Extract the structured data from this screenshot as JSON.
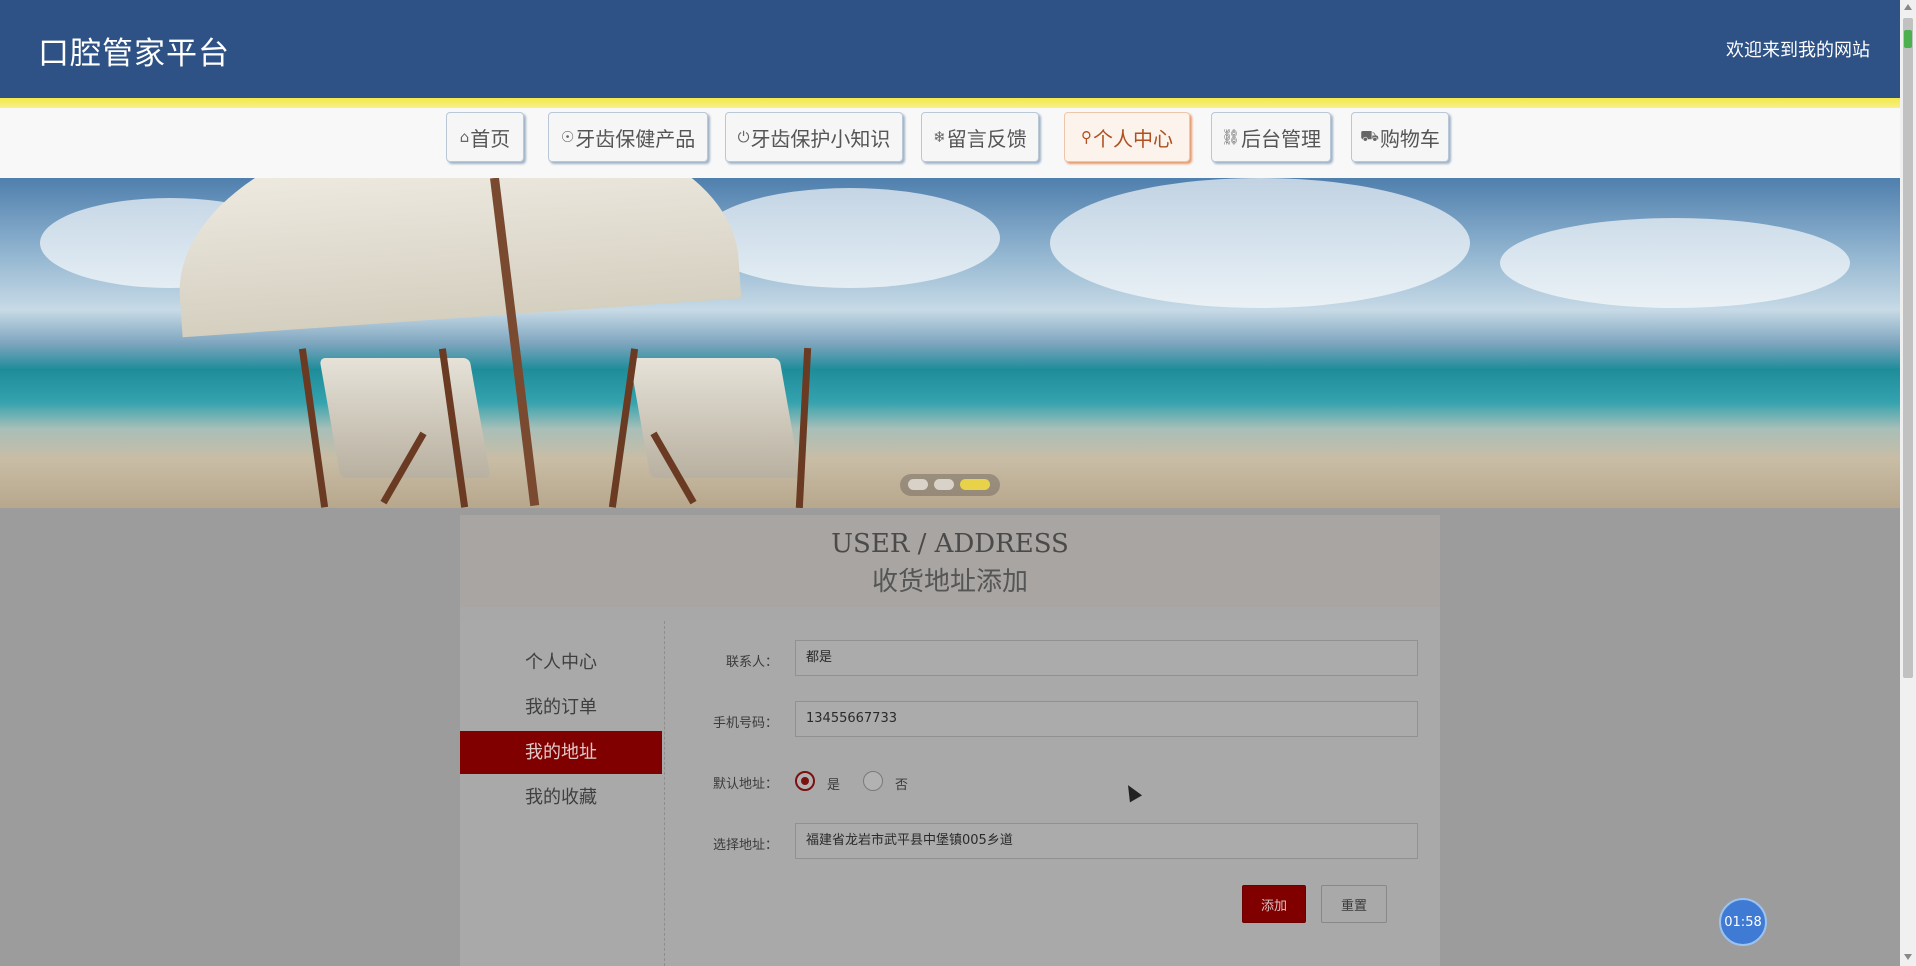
{
  "header": {
    "site_title": "口腔管家平台",
    "welcome": "欢迎来到我的网站"
  },
  "nav": {
    "items": [
      {
        "icon": "home-icon",
        "glyph": "⌂",
        "label": "首页"
      },
      {
        "icon": "product-icon",
        "glyph": "☉",
        "label": "牙齿保健产品"
      },
      {
        "icon": "knowledge-icon",
        "glyph": "⏻",
        "label": "牙齿保护小知识"
      },
      {
        "icon": "feedback-icon",
        "glyph": "❄",
        "label": "留言反馈"
      },
      {
        "icon": "user-icon",
        "glyph": "⚲",
        "label": "个人中心",
        "active": true
      },
      {
        "icon": "link-icon",
        "glyph": "⛓",
        "label": "后台管理"
      },
      {
        "icon": "cart-icon",
        "glyph": "⛟",
        "label": "购物车"
      }
    ]
  },
  "banner": {
    "slides": 3,
    "active_slide": 3
  },
  "page": {
    "title_en": "USER / ADDRESS",
    "title_cn": "收货地址添加"
  },
  "sidebar": {
    "items": [
      {
        "label": "个人中心"
      },
      {
        "label": "我的订单"
      },
      {
        "label": "我的地址",
        "active": true
      },
      {
        "label": "我的收藏"
      }
    ]
  },
  "form": {
    "contact_label": "联系人：",
    "contact_value": "都是",
    "phone_label": "手机号码：",
    "phone_value": "13455667733",
    "default_label": "默认地址：",
    "default_yes": "是",
    "default_no": "否",
    "default_selected": "是",
    "address_label": "选择地址：",
    "address_value": "福建省龙岩市武平县中堡镇005乡道",
    "add_button": "添加",
    "reset_button": "重置"
  },
  "timer": {
    "value": "01:58"
  },
  "colors": {
    "header_bg": "#2e5286",
    "accent_yellow": "#f3e94a",
    "active_red": "#800000",
    "nav_active": "#b05020",
    "timer_blue": "#3f7bd4"
  }
}
